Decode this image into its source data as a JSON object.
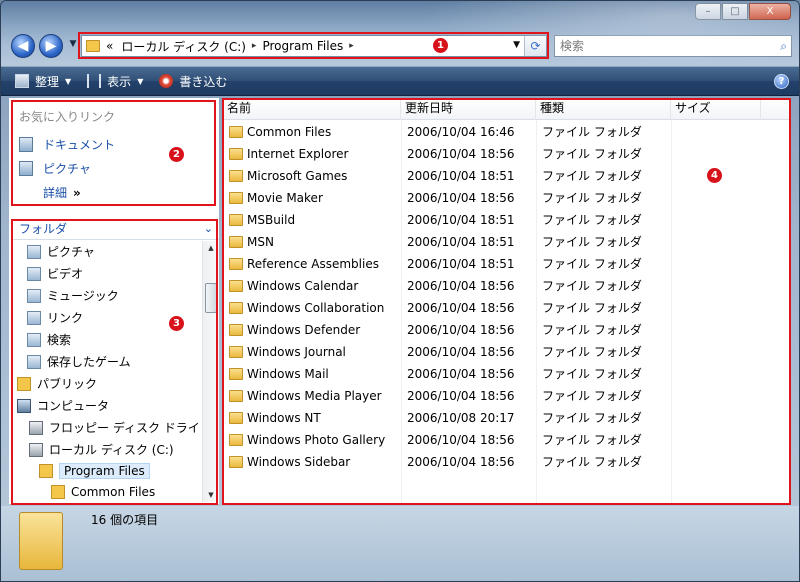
{
  "window": {
    "controls": {
      "minimize": "–",
      "maximize": "□",
      "close": "X"
    }
  },
  "nav": {
    "back": "◀",
    "forward": "▶",
    "dropdown": "▼"
  },
  "address": {
    "overflow": "«",
    "crumbs": [
      "ローカル ディスク (C:)",
      "Program Files"
    ],
    "separator": "▸",
    "dropdown": "▼",
    "refresh": "⟳"
  },
  "search": {
    "placeholder": "検索",
    "icon": "⌕"
  },
  "toolbar": {
    "organize": "整理",
    "views": "表示",
    "burn": "書き込む",
    "help": "?"
  },
  "favorites": {
    "title": "お気に入りリンク",
    "items": [
      "ドキュメント",
      "ピクチャ"
    ],
    "more": "詳細",
    "more_chev": "»"
  },
  "folders": {
    "title": "フォルダ",
    "chevron": "⌄",
    "items": [
      {
        "label": "ピクチャ",
        "icon": "pictures-icon"
      },
      {
        "label": "ビデオ",
        "icon": "videos-icon"
      },
      {
        "label": "ミュージック",
        "icon": "music-icon"
      },
      {
        "label": "リンク",
        "icon": "links-icon"
      },
      {
        "label": "検索",
        "icon": "searches-icon"
      },
      {
        "label": "保存したゲーム",
        "icon": "saved-games-icon"
      },
      {
        "label": "パブリック",
        "icon": "folder-icon"
      },
      {
        "label": "コンピュータ",
        "icon": "computer-icon"
      },
      {
        "label": "フロッピー ディスク ドライ",
        "icon": "floppy-icon"
      },
      {
        "label": "ローカル ディスク (C:)",
        "icon": "drive-icon"
      },
      {
        "label": "Program Files",
        "icon": "folder-icon"
      },
      {
        "label": "Common Files",
        "icon": "folder-icon"
      }
    ]
  },
  "columns": {
    "name": "名前",
    "date": "更新日時",
    "type": "種類",
    "size": "サイズ"
  },
  "files": [
    {
      "name": "Common Files",
      "date": "2006/10/04 16:46",
      "type": "ファイル フォルダ"
    },
    {
      "name": "Internet Explorer",
      "date": "2006/10/04 18:56",
      "type": "ファイル フォルダ"
    },
    {
      "name": "Microsoft Games",
      "date": "2006/10/04 18:51",
      "type": "ファイル フォルダ"
    },
    {
      "name": "Movie Maker",
      "date": "2006/10/04 18:56",
      "type": "ファイル フォルダ"
    },
    {
      "name": "MSBuild",
      "date": "2006/10/04 18:51",
      "type": "ファイル フォルダ"
    },
    {
      "name": "MSN",
      "date": "2006/10/04 18:51",
      "type": "ファイル フォルダ"
    },
    {
      "name": "Reference Assemblies",
      "date": "2006/10/04 18:51",
      "type": "ファイル フォルダ"
    },
    {
      "name": "Windows Calendar",
      "date": "2006/10/04 18:56",
      "type": "ファイル フォルダ"
    },
    {
      "name": "Windows Collaboration",
      "date": "2006/10/04 18:56",
      "type": "ファイル フォルダ"
    },
    {
      "name": "Windows Defender",
      "date": "2006/10/04 18:56",
      "type": "ファイル フォルダ"
    },
    {
      "name": "Windows Journal",
      "date": "2006/10/04 18:56",
      "type": "ファイル フォルダ"
    },
    {
      "name": "Windows Mail",
      "date": "2006/10/04 18:56",
      "type": "ファイル フォルダ"
    },
    {
      "name": "Windows Media Player",
      "date": "2006/10/04 18:56",
      "type": "ファイル フォルダ"
    },
    {
      "name": "Windows NT",
      "date": "2006/10/08 20:17",
      "type": "ファイル フォルダ"
    },
    {
      "name": "Windows Photo Gallery",
      "date": "2006/10/04 18:56",
      "type": "ファイル フォルダ"
    },
    {
      "name": "Windows Sidebar",
      "date": "2006/10/04 18:56",
      "type": "ファイル フォルダ"
    }
  ],
  "status": {
    "count_text": "16 個の項目"
  },
  "annotations": [
    "1",
    "2",
    "3",
    "4"
  ],
  "colors": {
    "annotation": "#e0141c",
    "link": "#1a4fa8",
    "toolbar": "#23416a"
  }
}
